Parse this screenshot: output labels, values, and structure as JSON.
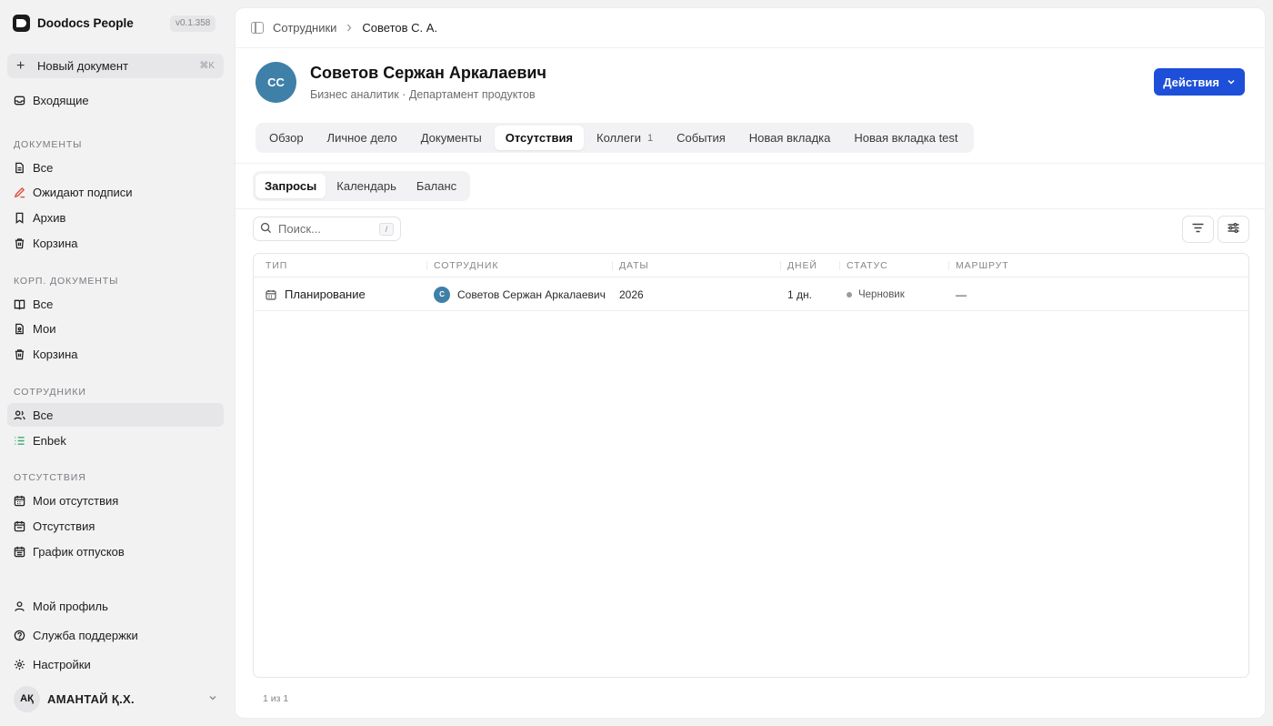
{
  "app": {
    "name": "Doodocs People",
    "version": "v0.1.358"
  },
  "sidebar": {
    "new_document": {
      "label": "Новый документ",
      "shortcut": "⌘K"
    },
    "inbox": "Входящие",
    "sections": {
      "documents": "ДОКУМЕНТЫ",
      "corp_documents": "КОРП. ДОКУМЕНТЫ",
      "employees": "СОТРУДНИКИ",
      "absences": "ОТСУТСТВИЯ"
    },
    "documents": [
      "Все",
      "Ожидают подписи",
      "Архив",
      "Корзина"
    ],
    "corp_documents": [
      "Все",
      "Мои",
      "Корзина"
    ],
    "employees": [
      "Все",
      "Enbek"
    ],
    "absences": [
      "Мои отсутствия",
      "Отсутствия",
      "График отпусков"
    ],
    "bottom": [
      "Мой профиль",
      "Служба поддержки",
      "Настройки"
    ],
    "user": {
      "initials": "AҚ",
      "name": "АМАНТАЙ Қ.Х."
    }
  },
  "breadcrumb": {
    "parent": "Сотрудники",
    "current": "Советов С. А."
  },
  "profile": {
    "initials": "СС",
    "name": "Советов Сержан Аркалаевич",
    "subtitle": "Бизнес аналитик · Департамент продуктов",
    "actions_label": "Действия"
  },
  "tabs": [
    {
      "label": "Обзор"
    },
    {
      "label": "Личное дело"
    },
    {
      "label": "Документы"
    },
    {
      "label": "Отсутствия",
      "active": true
    },
    {
      "label": "Коллеги",
      "count": "1"
    },
    {
      "label": "События"
    },
    {
      "label": "Новая вкладка"
    },
    {
      "label": "Новая вкладка test"
    }
  ],
  "subtabs": [
    "Запросы",
    "Календарь",
    "Баланс"
  ],
  "search": {
    "placeholder": "Поиск...",
    "shortcut": "/"
  },
  "table": {
    "columns": [
      "ТИП",
      "СОТРУДНИК",
      "ДАТЫ",
      "ДНЕЙ",
      "СТАТУС",
      "МАРШРУТ"
    ],
    "rows": [
      {
        "type": "Планирование",
        "employee_initial": "С",
        "employee": "Советов Сержан Аркалаевич",
        "dates": "2026",
        "days": "1 дн.",
        "status": "Черновик",
        "route": "—"
      }
    ]
  },
  "pagination": "1 из 1",
  "colors": {
    "accent": "#1d4fd8",
    "avatar": "#3f80a9",
    "pen": "#e0503f",
    "list": "#3cab6c"
  }
}
